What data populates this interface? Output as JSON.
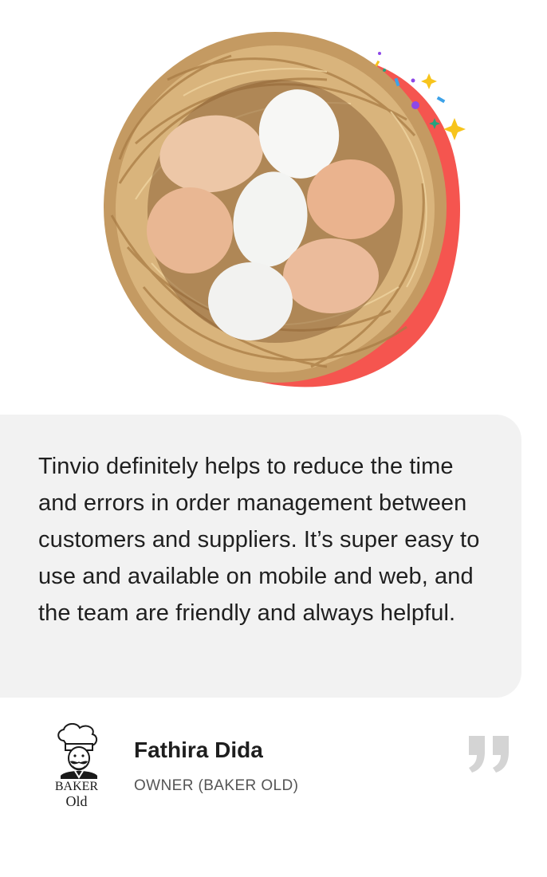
{
  "testimonial": {
    "quote": "Tinvio definitely helps to reduce the time and errors in order management between customers and suppliers. It’s super easy to use and available on mobile and web, and the team are friendly and always helpful.",
    "author_name": "Fathira Dida",
    "author_role": "OWNER (BAKER OLD)",
    "logo_line1": "BAKER",
    "logo_line2": "Old"
  },
  "icons": {
    "hero": "egg-nest-image",
    "logo": "baker-chef-logo",
    "quote": "closing-quote-icon"
  },
  "colors": {
    "card_background": "#f2f2f2",
    "accent_red": "#f5554f",
    "quote_mark": "#d4d4d4",
    "text": "#1f1f1f"
  }
}
